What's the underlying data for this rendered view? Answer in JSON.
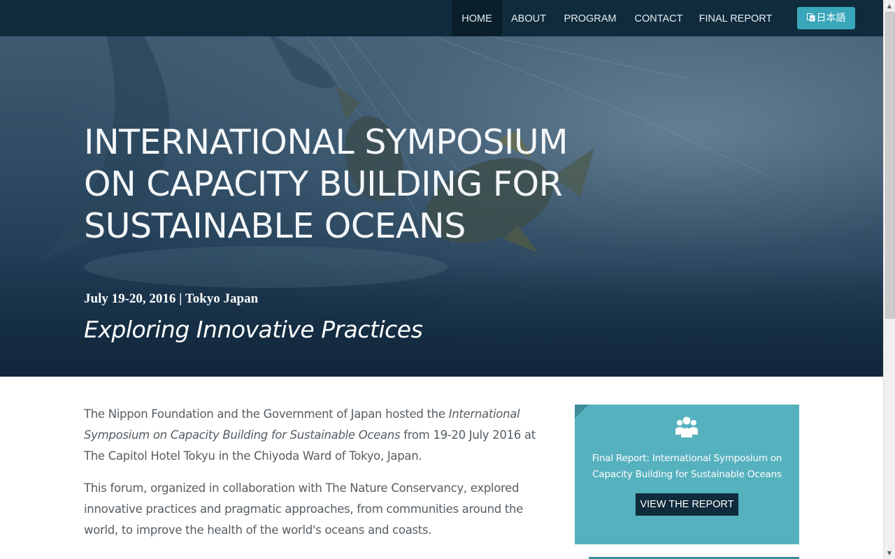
{
  "nav": {
    "items": [
      {
        "label": "HOME",
        "active": true
      },
      {
        "label": "ABOUT"
      },
      {
        "label": "PROGRAM"
      },
      {
        "label": "CONTACT"
      },
      {
        "label": "FINAL REPORT"
      }
    ],
    "language_button": {
      "label": "日本語",
      "icon": "translate-icon"
    }
  },
  "hero": {
    "title": "INTERNATIONAL SYMPOSIUM ON CAPACITY BUILDING FOR SUSTAINABLE OCEANS",
    "date": "July 19-20, 2016 | Tokyo Japan",
    "tagline": "Exploring Innovative Practices"
  },
  "content": {
    "p1_before": "The Nippon Foundation and the Government of Japan hosted the ",
    "p1_italic": "International Symposium on Capacity Building for Sustainable Oceans",
    "p1_after": " from 19-20 July 2016 at The Capitol Hotel Tokyu in the Chiyoda Ward of Tokyo, Japan.",
    "p2": "This forum, organized in collaboration with The Nature Conservancy, explored innovative practices and pragmatic approaches, from communities around the world, to improve the health of the world's oceans and coasts."
  },
  "report_card": {
    "icon": "people-group-icon",
    "text": "Final Report: International Symposium on Capacity Building for Sustainable Oceans",
    "button_label": "VIEW THE REPORT"
  },
  "colors": {
    "navbar": "#0f2b3c",
    "accent": "#3aa6b9",
    "card": "#56b1be",
    "button": "#0f2b3c"
  }
}
